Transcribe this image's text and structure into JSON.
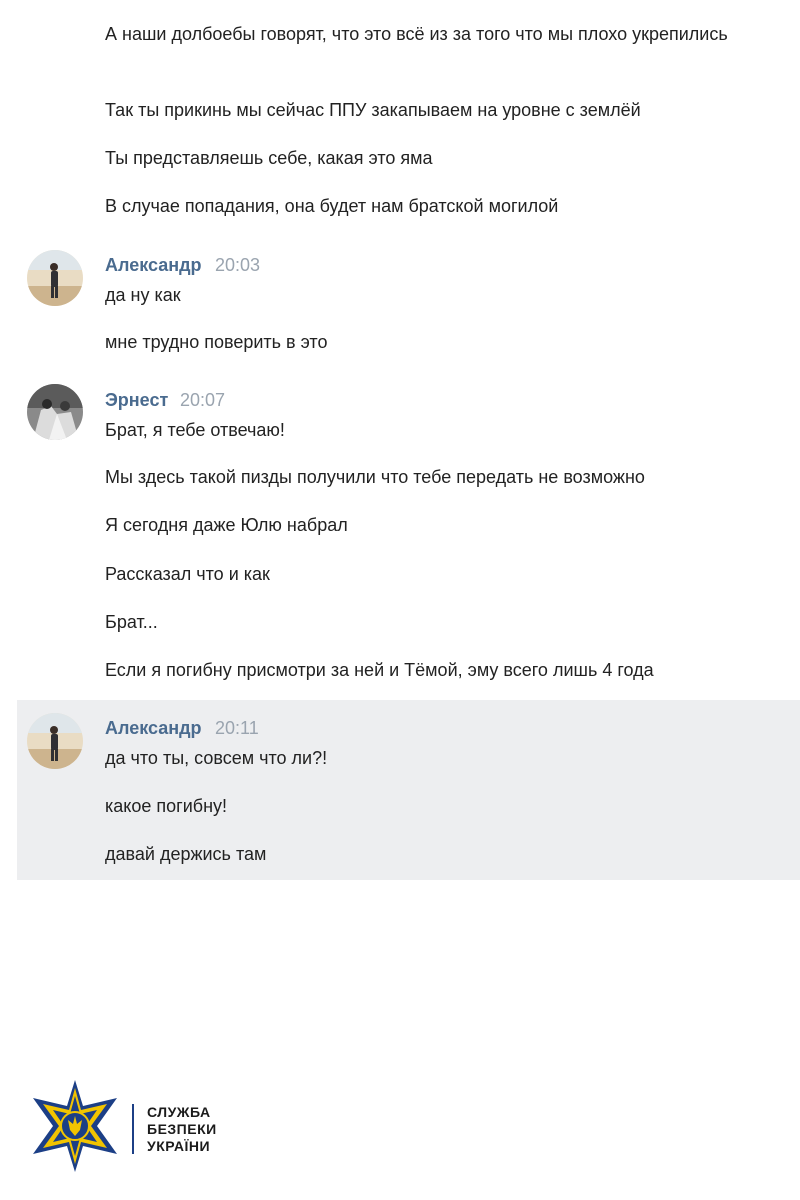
{
  "messages_top": [
    "А наши долбоебы говорят, что это всё из за того что мы плохо укрепились",
    "Так ты прикинь мы сейчас ППУ закапываем на уровне с землёй",
    "Ты представляешь себе, какая это яма",
    "В случае попадания, она будет нам братской могилой"
  ],
  "group1": {
    "author": "Александр",
    "time": "20:03",
    "lines": [
      "да ну как",
      "мне трудно поверить в это"
    ]
  },
  "group2": {
    "author": "Эрнест",
    "time": "20:07",
    "lines": [
      "Брат, я тебе отвечаю!",
      "Мы здесь такой пизды получили что тебе передать не возможно",
      "Я сегодня даже Юлю набрал",
      "Рассказал что и как",
      "Брат...",
      "Если я погибну присмотри за ней и Тёмой, эму всего лишь 4 года"
    ]
  },
  "group3": {
    "author": "Александр",
    "time": "20:11",
    "lines": [
      "да что ты, совсем что ли?!",
      "какое погибну!",
      "давай держись там"
    ]
  },
  "logo": {
    "line1": "СЛУЖБА",
    "line2": "БЕЗПЕКИ",
    "line3": "УКРАЇНИ"
  },
  "colors": {
    "author": "#4a6b8f",
    "time": "#9aa4af",
    "highlight_bg": "#edeef0",
    "logo_blue": "#1c3f86",
    "logo_gold": "#f2c400"
  }
}
